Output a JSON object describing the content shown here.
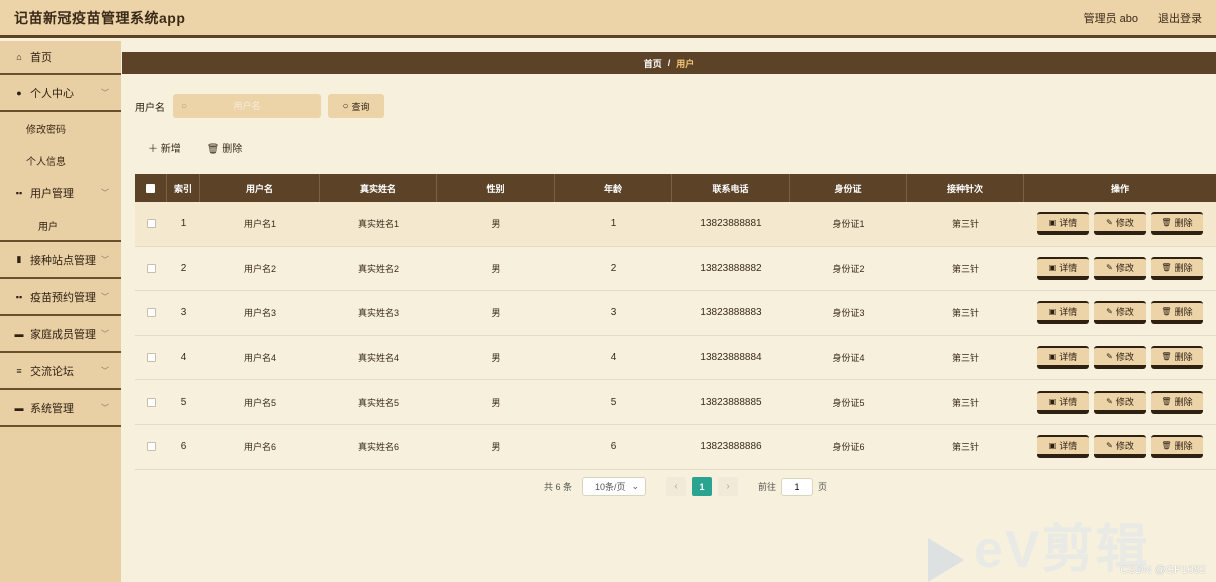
{
  "header": {
    "title": "记苗新冠疫苗管理系统app",
    "user": "管理员 abo",
    "logout": "退出登录"
  },
  "sidebar": {
    "home": "首页",
    "personal": "个人中心",
    "change_password": "修改密码",
    "personal_info": "个人信息",
    "user_mgmt": "用户管理",
    "user": "用户",
    "site_mgmt": "接种站点管理",
    "booking_mgmt": "疫苗预约管理",
    "family_mgmt": "家庭成员管理",
    "forum": "交流论坛",
    "system_mgmt": "系统管理"
  },
  "breadcrumb": {
    "home": "首页",
    "sep": "/",
    "current": "用户"
  },
  "search": {
    "label": "用户名",
    "placeholder": "用户名",
    "value": "",
    "button": "查询"
  },
  "actions": {
    "add": "新增",
    "delete": "删除"
  },
  "table": {
    "headers": [
      "索引",
      "用户名",
      "真实姓名",
      "性别",
      "年龄",
      "联系电话",
      "身份证",
      "接种针次",
      "操作"
    ],
    "rows": [
      {
        "index": "1",
        "username": "用户名1",
        "realname": "真实姓名1",
        "sex": "男",
        "age": "1",
        "phone": "13823888881",
        "idcard": "身份证1",
        "dose": "第三针"
      },
      {
        "index": "2",
        "username": "用户名2",
        "realname": "真实姓名2",
        "sex": "男",
        "age": "2",
        "phone": "13823888882",
        "idcard": "身份证2",
        "dose": "第三针"
      },
      {
        "index": "3",
        "username": "用户名3",
        "realname": "真实姓名3",
        "sex": "男",
        "age": "3",
        "phone": "13823888883",
        "idcard": "身份证3",
        "dose": "第三针"
      },
      {
        "index": "4",
        "username": "用户名4",
        "realname": "真实姓名4",
        "sex": "男",
        "age": "4",
        "phone": "13823888884",
        "idcard": "身份证4",
        "dose": "第三针"
      },
      {
        "index": "5",
        "username": "用户名5",
        "realname": "真实姓名5",
        "sex": "男",
        "age": "5",
        "phone": "13823888885",
        "idcard": "身份证5",
        "dose": "第三针"
      },
      {
        "index": "6",
        "username": "用户名6",
        "realname": "真实姓名6",
        "sex": "男",
        "age": "6",
        "phone": "13823888886",
        "idcard": "身份证6",
        "dose": "第三针"
      }
    ],
    "row_buttons": {
      "detail": "详情",
      "edit": "修改",
      "delete": "删除"
    }
  },
  "pagination": {
    "total": "共 6 条",
    "page_size": "10条/页",
    "current_page": "1",
    "goto_label": "前往",
    "goto_value": "1",
    "page_unit": "页"
  },
  "watermark": {
    "csdn": "CSDN @GP1082",
    "logo": "eV剪辑"
  }
}
